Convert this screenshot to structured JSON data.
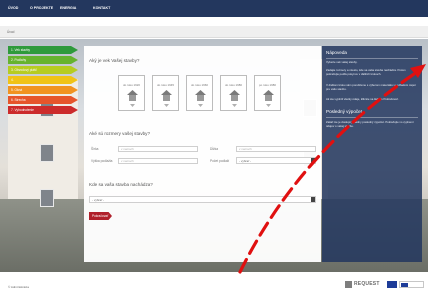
{
  "nav": {
    "items": [
      "ÚVOD",
      "O PROJEKTE",
      "ENERGIA",
      "KONTAKT"
    ],
    "bg_color": "#23375e"
  },
  "breadcrumb": "Úvod",
  "steps": [
    {
      "label": "1. Vek stavby",
      "color": "#2e9a3b"
    },
    {
      "label": "2. Podlahy",
      "color": "#66b32e"
    },
    {
      "label": "3. Obvodový plášť",
      "color": "#b6cc21"
    },
    {
      "label": "4.",
      "color": "#f0c316"
    },
    {
      "label": "5. Okná",
      "color": "#f19320"
    },
    {
      "label": "6. Strecha",
      "color": "#e6552b"
    },
    {
      "label": "7. Vyhodnotenie",
      "color": "#cc2b2b"
    }
  ],
  "form": {
    "question1": "Aký je vek Vašej stavby?",
    "age_cards": [
      "do roku 1920",
      "do roku 1945",
      "do roku 1960",
      "do roku 1980",
      "po roku 1980"
    ],
    "question2": "Aké sú rozmery vašej stavby?",
    "fields": {
      "sirka_label": "Šírka",
      "sirka_placeholder": "v metroch",
      "dlzka_label": "Dĺžka",
      "dlzka_placeholder": "v metroch",
      "vyska_label": "Výška podlažia",
      "vyska_placeholder": "v metroch",
      "pocet_label": "Počet podlaží",
      "pocet_value": "- vybrať -"
    },
    "question3": "Kde sa vaša stavba nachádza?",
    "location_value": "- vybrať -",
    "continue_button": "Pokračovať",
    "button_color": "#b0202b"
  },
  "sidebar": {
    "title1": "Nápoveda",
    "p1": "Vyberte vek vašej stavby.",
    "p2": "Zadajte rozmery a miesto, kde sa vaša stavba nachádza. Potom pokračujte podľa pokynov v ďalších krokoch.",
    "p3": "V ďalšom kroku vám pomôžeme s výberom materiálov a odhadom úspor pre vašu stavbu.",
    "p4": "Ak ste vyplnili všetky údaje, kliknite na tlačidlo Pokračovať.",
    "title2": "Posledný výpočet",
    "p5": "Zatiaľ nie je dostupný žiadny posledný výpočet. Pokračujte vo vyplnení údajov o vašej stavbe.",
    "bg_color": "#23375e"
  },
  "footer": {
    "left_text": "© Administrácia",
    "logo_text": "REQUEST"
  },
  "annotation": {
    "arrow_color": "#e01010"
  }
}
